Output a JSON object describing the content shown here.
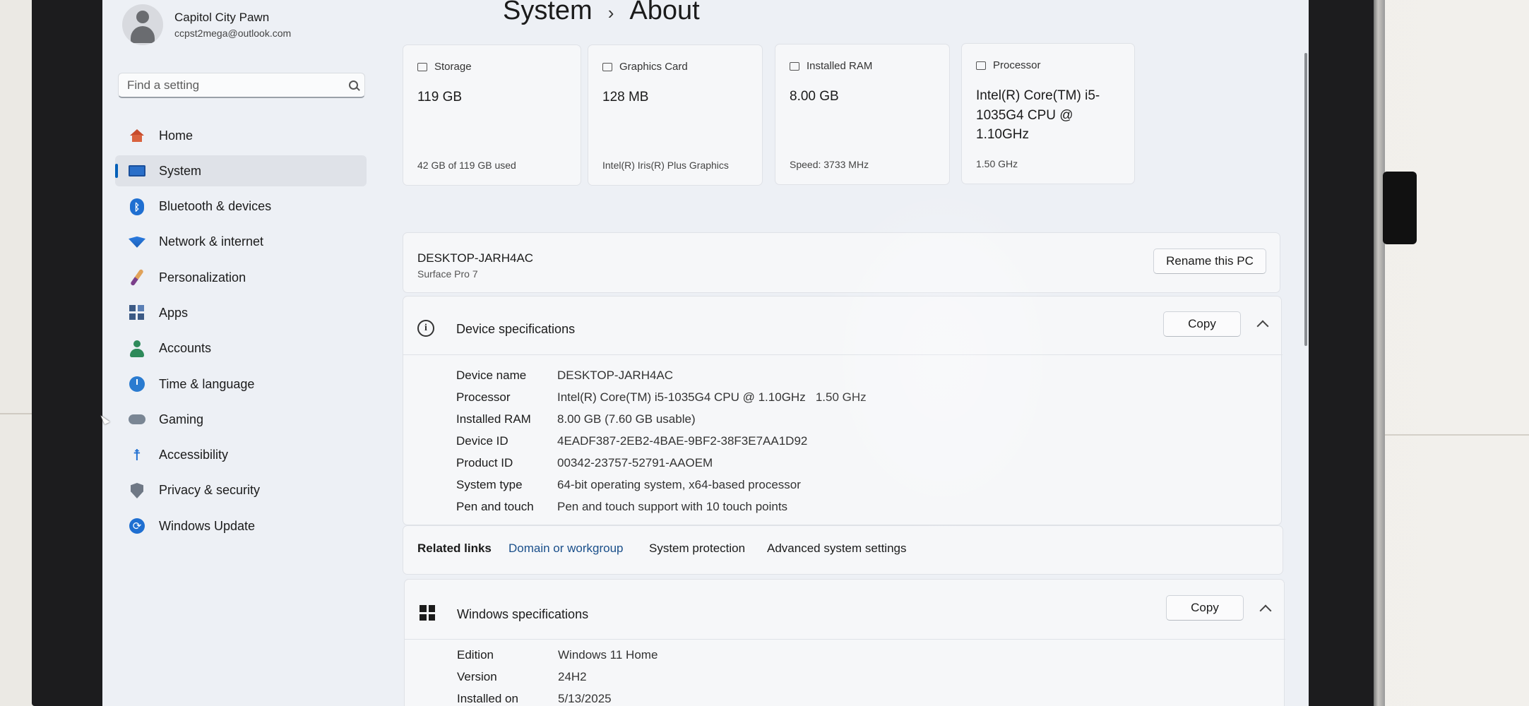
{
  "profile": {
    "name": "Capitol City Pawn",
    "email": "ccpst2mega@outlook.com"
  },
  "search": {
    "placeholder": "Find a setting"
  },
  "nav": [
    {
      "label": "Home",
      "icon": "home-icon"
    },
    {
      "label": "System",
      "icon": "system-icon",
      "selected": true
    },
    {
      "label": "Bluetooth & devices",
      "icon": "bluetooth-icon"
    },
    {
      "label": "Network & internet",
      "icon": "wifi-icon"
    },
    {
      "label": "Personalization",
      "icon": "brush-icon"
    },
    {
      "label": "Apps",
      "icon": "apps-icon"
    },
    {
      "label": "Accounts",
      "icon": "accounts-icon"
    },
    {
      "label": "Time & language",
      "icon": "globe-clock-icon"
    },
    {
      "label": "Gaming",
      "icon": "gamepad-icon"
    },
    {
      "label": "Accessibility",
      "icon": "accessibility-icon"
    },
    {
      "label": "Privacy & security",
      "icon": "shield-icon"
    },
    {
      "label": "Windows Update",
      "icon": "update-icon"
    }
  ],
  "breadcrumb": {
    "parent": "System",
    "separator": "›",
    "current": "About"
  },
  "cards": [
    {
      "title": "Storage",
      "value": "119 GB",
      "sub": "42 GB of 119 GB used",
      "icon": "storage-icon"
    },
    {
      "title": "Graphics Card",
      "value": "128 MB",
      "sub": "Intel(R) Iris(R) Plus Graphics",
      "icon": "graphics-card-icon"
    },
    {
      "title": "Installed RAM",
      "value": "8.00 GB",
      "sub": "Speed: 3733 MHz",
      "icon": "ram-icon"
    },
    {
      "title": "Processor",
      "value": "Intel(R) Core(TM) i5-1035G4 CPU @ 1.10GHz",
      "sub": "1.50 GHz",
      "icon": "processor-icon"
    }
  ],
  "pc": {
    "name": "DESKTOP-JARH4AC",
    "model": "Surface Pro 7",
    "rename_label": "Rename this PC"
  },
  "device_specs": {
    "title": "Device specifications",
    "copy_label": "Copy",
    "rows": [
      {
        "label": "Device name",
        "value": "DESKTOP-JARH4AC"
      },
      {
        "label": "Processor",
        "value": "Intel(R) Core(TM) i5-1035G4 CPU @ 1.10GHz   1.50 GHz"
      },
      {
        "label": "Installed RAM",
        "value": "8.00 GB (7.60 GB usable)"
      },
      {
        "label": "Device ID",
        "value": "4EADF387-2EB2-4BAE-9BF2-38F3E7AA1D92"
      },
      {
        "label": "Product ID",
        "value": "00342-23757-52791-AAOEM"
      },
      {
        "label": "System type",
        "value": "64-bit operating system, x64-based processor"
      },
      {
        "label": "Pen and touch",
        "value": "Pen and touch support with 10 touch points"
      }
    ]
  },
  "related": {
    "label": "Related links",
    "links": [
      "Domain or workgroup",
      "System protection",
      "Advanced system settings"
    ]
  },
  "windows_specs": {
    "title": "Windows specifications",
    "copy_label": "Copy",
    "rows": [
      {
        "label": "Edition",
        "value": "Windows 11 Home"
      },
      {
        "label": "Version",
        "value": "24H2"
      },
      {
        "label": "Installed on",
        "value": "5/13/2025"
      }
    ]
  },
  "colors": {
    "accent": "#005fb8",
    "link": "#1a4f8a",
    "background": "#edf0f5",
    "card": "#f6f7f9"
  }
}
